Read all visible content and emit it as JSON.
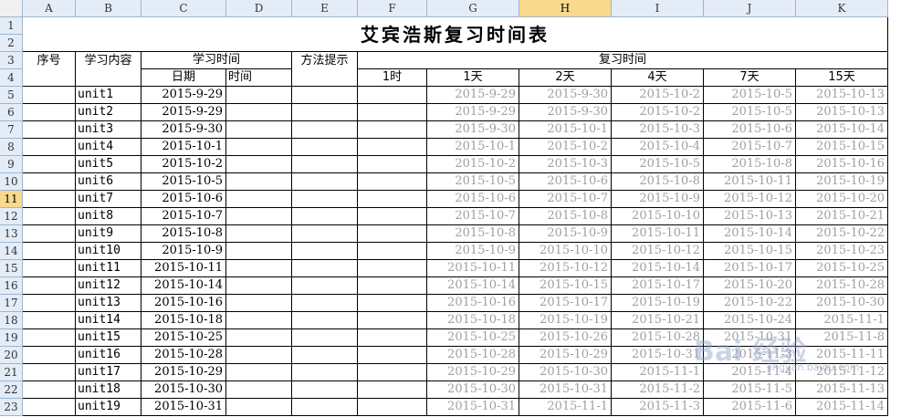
{
  "columns": [
    "A",
    "B",
    "C",
    "D",
    "E",
    "F",
    "G",
    "H",
    "I",
    "J",
    "K"
  ],
  "selected_column": "H",
  "rows": [
    "1",
    "2",
    "3",
    "4",
    "5",
    "6",
    "7",
    "8",
    "9",
    "10",
    "11",
    "12",
    "13",
    "14",
    "15",
    "16",
    "17",
    "18",
    "19",
    "20",
    "21",
    "22",
    "23"
  ],
  "selected_row": "11",
  "sheet": {
    "title": "艾宾浩斯复习时间表",
    "header": {
      "seq": "序号",
      "content": "学习内容",
      "study_time": "学习时间",
      "date": "日期",
      "time": "时间",
      "method": "方法提示",
      "review_time": "复习时间",
      "intervals": [
        "1时",
        "1天",
        "2天",
        "4天",
        "7天",
        "15天"
      ]
    },
    "records": [
      {
        "unit": "unit1",
        "date": "2015-9-29",
        "r1": "2015-9-29",
        "r2": "2015-9-30",
        "r4": "2015-10-2",
        "r7": "2015-10-5",
        "r15": "2015-10-13"
      },
      {
        "unit": "unit2",
        "date": "2015-9-29",
        "r1": "2015-9-29",
        "r2": "2015-9-30",
        "r4": "2015-10-2",
        "r7": "2015-10-5",
        "r15": "2015-10-13"
      },
      {
        "unit": "unit3",
        "date": "2015-9-30",
        "r1": "2015-9-30",
        "r2": "2015-10-1",
        "r4": "2015-10-3",
        "r7": "2015-10-6",
        "r15": "2015-10-14"
      },
      {
        "unit": "unit4",
        "date": "2015-10-1",
        "r1": "2015-10-1",
        "r2": "2015-10-2",
        "r4": "2015-10-4",
        "r7": "2015-10-7",
        "r15": "2015-10-15"
      },
      {
        "unit": "unit5",
        "date": "2015-10-2",
        "r1": "2015-10-2",
        "r2": "2015-10-3",
        "r4": "2015-10-5",
        "r7": "2015-10-8",
        "r15": "2015-10-16"
      },
      {
        "unit": "unit6",
        "date": "2015-10-5",
        "r1": "2015-10-5",
        "r2": "2015-10-6",
        "r4": "2015-10-8",
        "r7": "2015-10-11",
        "r15": "2015-10-19"
      },
      {
        "unit": "unit7",
        "date": "2015-10-6",
        "r1": "2015-10-6",
        "r2": "2015-10-7",
        "r4": "2015-10-9",
        "r7": "2015-10-12",
        "r15": "2015-10-20"
      },
      {
        "unit": "unit8",
        "date": "2015-10-7",
        "r1": "2015-10-7",
        "r2": "2015-10-8",
        "r4": "2015-10-10",
        "r7": "2015-10-13",
        "r15": "2015-10-21"
      },
      {
        "unit": "unit9",
        "date": "2015-10-8",
        "r1": "2015-10-8",
        "r2": "2015-10-9",
        "r4": "2015-10-11",
        "r7": "2015-10-14",
        "r15": "2015-10-22"
      },
      {
        "unit": "unit10",
        "date": "2015-10-9",
        "r1": "2015-10-9",
        "r2": "2015-10-10",
        "r4": "2015-10-12",
        "r7": "2015-10-15",
        "r15": "2015-10-23"
      },
      {
        "unit": "unit11",
        "date": "2015-10-11",
        "r1": "2015-10-11",
        "r2": "2015-10-12",
        "r4": "2015-10-14",
        "r7": "2015-10-17",
        "r15": "2015-10-25"
      },
      {
        "unit": "unit12",
        "date": "2015-10-14",
        "r1": "2015-10-14",
        "r2": "2015-10-15",
        "r4": "2015-10-17",
        "r7": "2015-10-20",
        "r15": "2015-10-28"
      },
      {
        "unit": "unit13",
        "date": "2015-10-16",
        "r1": "2015-10-16",
        "r2": "2015-10-17",
        "r4": "2015-10-19",
        "r7": "2015-10-22",
        "r15": "2015-10-30"
      },
      {
        "unit": "unit14",
        "date": "2015-10-18",
        "r1": "2015-10-18",
        "r2": "2015-10-19",
        "r4": "2015-10-21",
        "r7": "2015-10-24",
        "r15": "2015-11-1"
      },
      {
        "unit": "unit15",
        "date": "2015-10-25",
        "r1": "2015-10-25",
        "r2": "2015-10-26",
        "r4": "2015-10-28",
        "r7": "2015-10-31",
        "r15": "2015-11-8"
      },
      {
        "unit": "unit16",
        "date": "2015-10-28",
        "r1": "2015-10-28",
        "r2": "2015-10-29",
        "r4": "2015-10-31",
        "r7": "2015-11-3",
        "r15": "2015-11-11"
      },
      {
        "unit": "unit17",
        "date": "2015-10-29",
        "r1": "2015-10-29",
        "r2": "2015-10-30",
        "r4": "2015-11-1",
        "r7": "2015-11-4",
        "r15": "2015-11-12"
      },
      {
        "unit": "unit18",
        "date": "2015-10-30",
        "r1": "2015-10-30",
        "r2": "2015-10-31",
        "r4": "2015-11-2",
        "r7": "2015-11-5",
        "r15": "2015-11-13"
      },
      {
        "unit": "unit19",
        "date": "2015-10-31",
        "r1": "2015-10-31",
        "r2": "2015-11-1",
        "r4": "2015-11-3",
        "r7": "2015-11-6",
        "r15": "2015-11-14"
      }
    ]
  },
  "watermark": {
    "text": "Bai 经验",
    "sub": "jingyan.baidu.com"
  },
  "colors": {
    "header_bg": "#e4ecf7",
    "selected_header_bg": "#f8d98e",
    "grid_line": "#000000",
    "dim_text": "#a0a0a0"
  }
}
